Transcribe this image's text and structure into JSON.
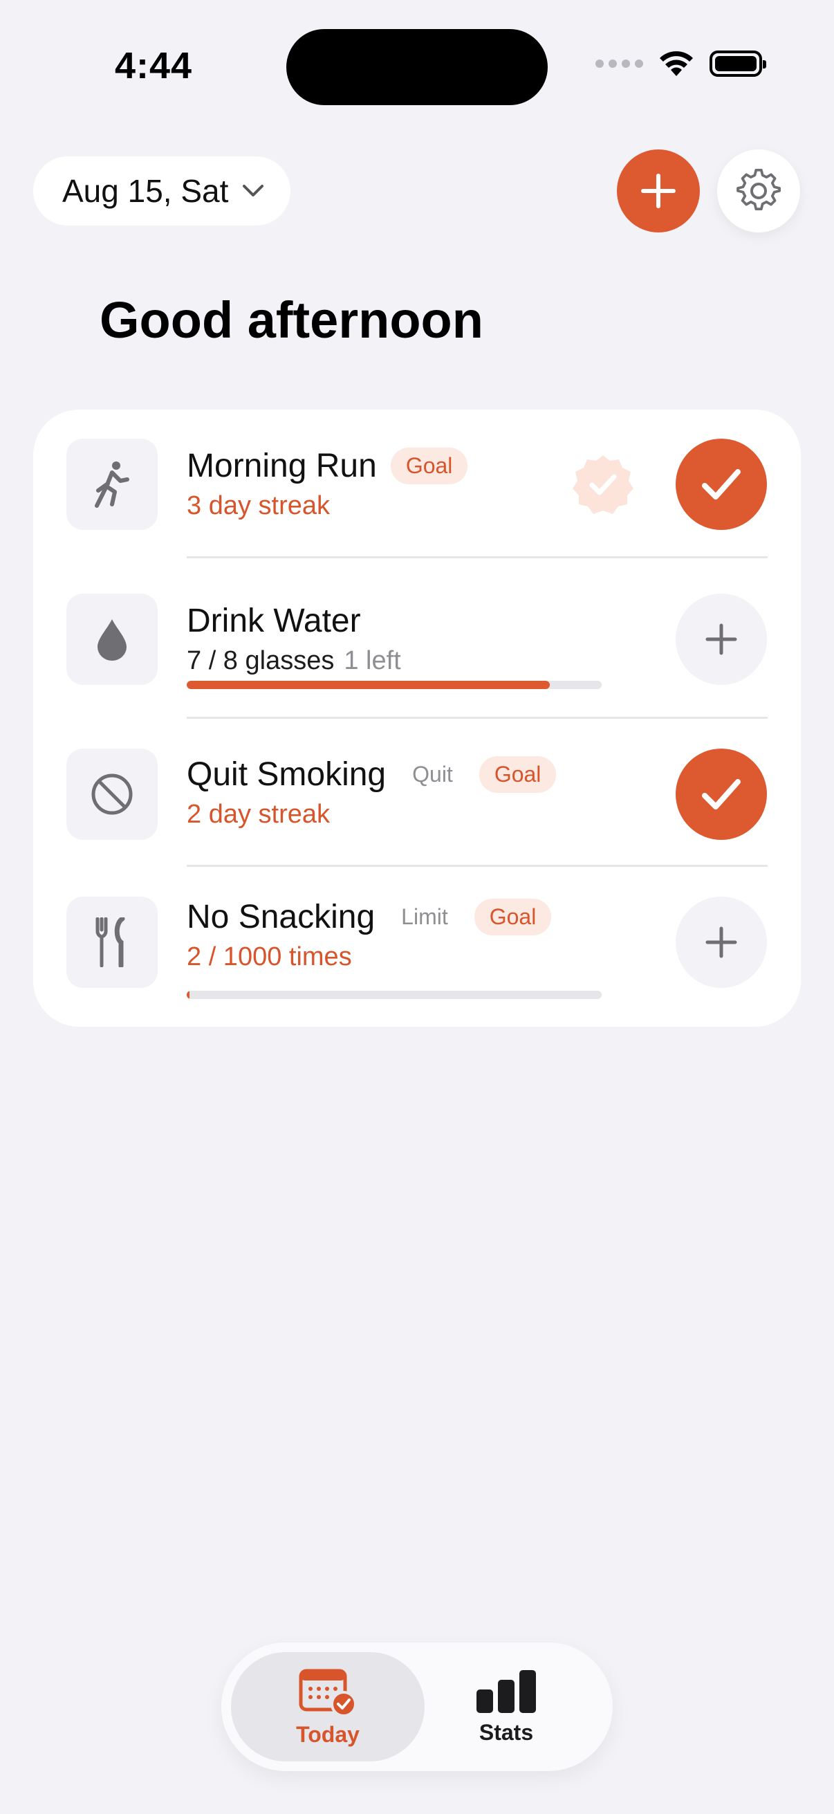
{
  "status_bar": {
    "time": "4:44"
  },
  "header": {
    "date_label": "Aug 15, Sat",
    "greeting": "Good afternoon"
  },
  "colors": {
    "accent": "#DD5A31",
    "background": "#F2F2F7"
  },
  "habits": [
    {
      "title": "Morning Run",
      "tag": "Goal",
      "subtitle": "3 day streak",
      "icon": "running-icon",
      "done": true
    },
    {
      "title": "Drink Water",
      "subtitle": "7 / 8 glasses",
      "subtitle_extra": "1 left",
      "icon": "water-drop-icon",
      "progress": 0.875,
      "done": false
    },
    {
      "title": "Quit Smoking",
      "type": "Quit",
      "tag": "Goal",
      "subtitle": "2 day streak",
      "icon": "prohibited-icon",
      "done": true
    },
    {
      "title": "No Snacking",
      "type": "Limit",
      "tag": "Goal",
      "subtitle": "2 / 1000 times",
      "icon": "fork-knife-icon",
      "progress": 0.002,
      "done": false
    }
  ],
  "tabbar": {
    "tabs": [
      {
        "label": "Today",
        "icon": "calendar-check-icon",
        "active": true
      },
      {
        "label": "Stats",
        "icon": "bar-chart-icon",
        "active": false
      }
    ]
  }
}
